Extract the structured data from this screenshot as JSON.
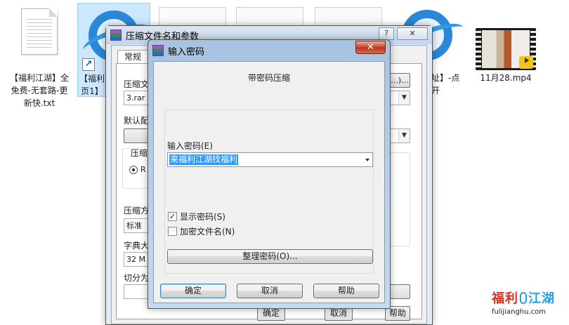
{
  "desktop_files": [
    {
      "label_lines": [
        "【福利江湖】全",
        "免费-无套路-更",
        "新快.txt"
      ]
    },
    {
      "label_lines": [
        "【福利",
        "页1】"
      ]
    },
    {
      "label_lines": []
    },
    {
      "label_lines": []
    },
    {
      "label_lines": []
    },
    {
      "label_lines": [
        "址】-点",
        "开"
      ]
    },
    {
      "label_lines": [
        "11月28.mp4"
      ]
    }
  ],
  "back_window": {
    "title": "压缩文件名和参数",
    "help_btn": "?",
    "tab_general": "常规",
    "archive_name_label": "压缩文",
    "archive_name_value": "3.rar",
    "browse_btn": "...)...",
    "default_profile_label": "默认配",
    "format_label": "压缩",
    "format_option": "R",
    "method_label": "压缩方",
    "method_value": "标准",
    "dict_label": "字典大",
    "dict_value": "32 M",
    "split_label": "切分为",
    "ok_btn": "确定",
    "cancel_btn": "取消",
    "help_btn_bottom": "帮助"
  },
  "pw_dialog": {
    "title": "输入密码",
    "close_btn": "✕",
    "subtitle": "带密码压缩",
    "password_label": "输入密码(E)",
    "password_value": "来福利江湖找福利",
    "show_password": {
      "label": "显示密码(S)",
      "checked": true,
      "mark": "✓"
    },
    "encrypt_names": {
      "label": "加密文件名(N)",
      "checked": false
    },
    "organize_btn": "整理密码(O)...",
    "ok_btn": "确定",
    "cancel_btn": "取消",
    "help_btn": "帮助"
  },
  "watermark": {
    "brand_left": "福利",
    "brand_right": "江湖",
    "url": "fulijianghu.com"
  },
  "colors": {
    "selection": "#3399ff",
    "close_red": "#c8452c",
    "brand_red": "#d9301f",
    "brand_blue": "#2a9fd8"
  }
}
